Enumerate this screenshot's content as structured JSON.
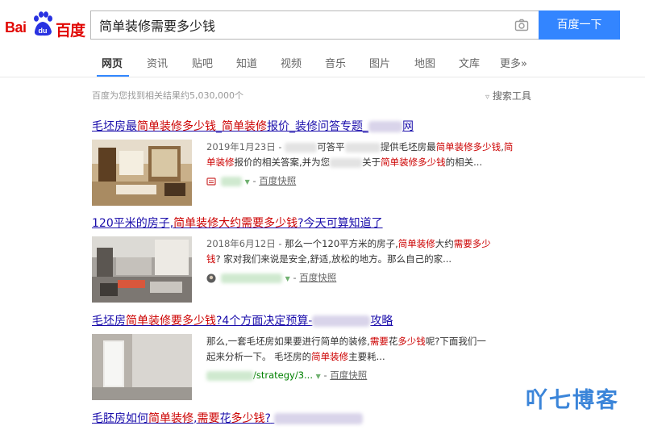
{
  "logo": {
    "part1": "Bai",
    "part2": "百度",
    "paw_text": "du"
  },
  "search": {
    "query": "简单装修需要多少钱",
    "button": "百度一下"
  },
  "tabs": [
    "网页",
    "资讯",
    "贴吧",
    "知道",
    "视频",
    "音乐",
    "图片",
    "地图",
    "文库",
    "更多»"
  ],
  "meta": {
    "result_count": "百度为您找到相关结果约5,030,000个",
    "tools": "搜索工具"
  },
  "results": [
    {
      "title": {
        "t1": "毛坯房最",
        "h1": "简单装修多少钱",
        "t2": "_",
        "h2": "简单装修",
        "t3": "报价_装修问答专题_",
        "t4": "网"
      },
      "date": "2019年1月23日 -",
      "line1": {
        "a": "可答平",
        "b": "提供毛坯房最",
        "h1": "简单装修多少钱",
        "c": ",",
        "h2": "简"
      },
      "line2": {
        "h1": "单装修",
        "a": "报价的相关答案,并为您",
        "b": "关于",
        "h2": "简单装修多少钱",
        "c": "的相关..."
      },
      "source": {
        "kuaizhao": "百度快照"
      }
    },
    {
      "title": {
        "t1": "120平米的房子,",
        "h1": "简单装修大约需要多少钱",
        "t2": "?今天可算知道了"
      },
      "date": "2018年6月12日 -",
      "line1": {
        "a": "那么一个120平方米的房子,",
        "h1": "简单装修",
        "b": "大约",
        "h2": "需要多少"
      },
      "line2": {
        "h1": "钱",
        "a": "? 家对我们来说是安全,舒适,放松的地方。那么自己的家..."
      },
      "source": {
        "kuaizhao": "百度快照"
      }
    },
    {
      "title": {
        "t1": "毛坯房",
        "h1": "简单装修要多少钱",
        "t2": "?4个方面决定预算-",
        "t3": "攻略"
      },
      "line1": {
        "a": "那么,一套毛坯房如果要进行简单的装修,",
        "h1": "需要",
        "b": "花",
        "h2": "多少钱",
        "c": "呢?下面我们一"
      },
      "line2": {
        "a": "起来分析一下。 毛坯房的",
        "h1": "简单装修",
        "b": "主要耗..."
      },
      "source": {
        "url": "/strategy/3...",
        "kuaizhao": "百度快照"
      }
    },
    {
      "title": {
        "t1": "毛胚房如何",
        "h1": "简单装修",
        "t2": ",",
        "h2": "需要",
        "t3": "花",
        "h3": "多少钱",
        "t4": "?"
      }
    }
  ],
  "watermark": "吖七博客",
  "colors": {
    "accent": "#3385ff",
    "link": "#1a0dab",
    "highlight": "#cc0000",
    "url_green": "#008000"
  }
}
